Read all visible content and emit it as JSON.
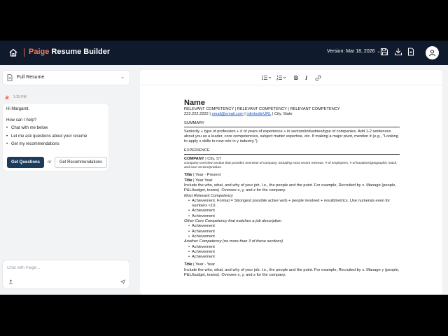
{
  "header": {
    "brand_accent": "Paige",
    "brand_rest": " Resume Builder",
    "version_label": "Version:",
    "version_value": "Mar 18, 2026"
  },
  "colors": {
    "topbar": "#0f1a2c",
    "brand_accent": "#f07a5c",
    "primary_button": "#1d3c5c",
    "link": "#1a56c9"
  },
  "icons": {
    "home": "home-icon",
    "save": "save-icon",
    "download": "download-icon",
    "export": "export-icon",
    "user": "user-icon",
    "bullet_list": "bullet-list-icon",
    "numbered_list": "numbered-list-icon",
    "bold": "bold-icon",
    "italic": "italic-icon",
    "link": "link-icon"
  },
  "sidebar": {
    "resume_select": "Full Resume",
    "time": "1:25 PM",
    "greeting": "Hi Margaret,",
    "help": "How can I help?",
    "options": [
      "Chat with me below",
      "Let me ask questions about your resume",
      "Get my recommendations"
    ],
    "btn_questions": "Get Questions",
    "or": "or",
    "btn_recommendations": "Get Recommendations",
    "chat_placeholder": "Chat with Paige..."
  },
  "toolbar": {
    "bold": "B",
    "italic": "I"
  },
  "resume": {
    "name": "Name",
    "competencies": "RELEVANT COMPETENCY | RELEVANT COMPETENCY | RELEVANT COMPETENCY",
    "phone": "222.222.2222 | ",
    "email": "email@email.com",
    "sep1": " | ",
    "linkedin": "inlinkedinURL",
    "location": " | City, State",
    "summary_head": "SUMMARY",
    "summary_text": "Seniority + type of profession + # of years of experience + in sectors/industries/type of companies. Add 1-2 sentences about you as a leader, core competencies, subject matter expertise, etc. If making a major pivot, mention it (e.g., \"Looking to apply x skills to new role in y industry.\").",
    "experience_head": "EXPERIENCE",
    "company": "COMPANY",
    "company_loc": " | City, ST",
    "company_desc": "Company overview section that provides overview of company, including most recent revenue, # of employees, # of locations/geographic reach, and core service/product.",
    "title1": "Title",
    "title1_rest": " | Year - Present",
    "title2": "Title",
    "title2_rest": " | Year Year",
    "role_desc": "Include the who, what, and why of your job. I.e., the people and the point. For example, Recruited by x. Manage (people, P&L/budget, teams). Oversee x, y, and z for the company.",
    "most_relevant": "Most Relevant Competency",
    "achievement_main": "Achievement. Format = Strongest possible active verb + people involved + result/metrics. Use numerals even for numbers <10.",
    "achievement": "Achievement",
    "other_core": "Other Core Competency that matches a job description",
    "another": "Another Competency (no more than 3 of these sections)",
    "title3": "Title",
    "title3_rest": " | Year - Year",
    "role_desc2": "Include the who, what, and why of your job. I.e., the people and the point. For example, Recruited by x. Manage y (people, P&L/budget, teams). Oversee x, y, and z for the company."
  }
}
